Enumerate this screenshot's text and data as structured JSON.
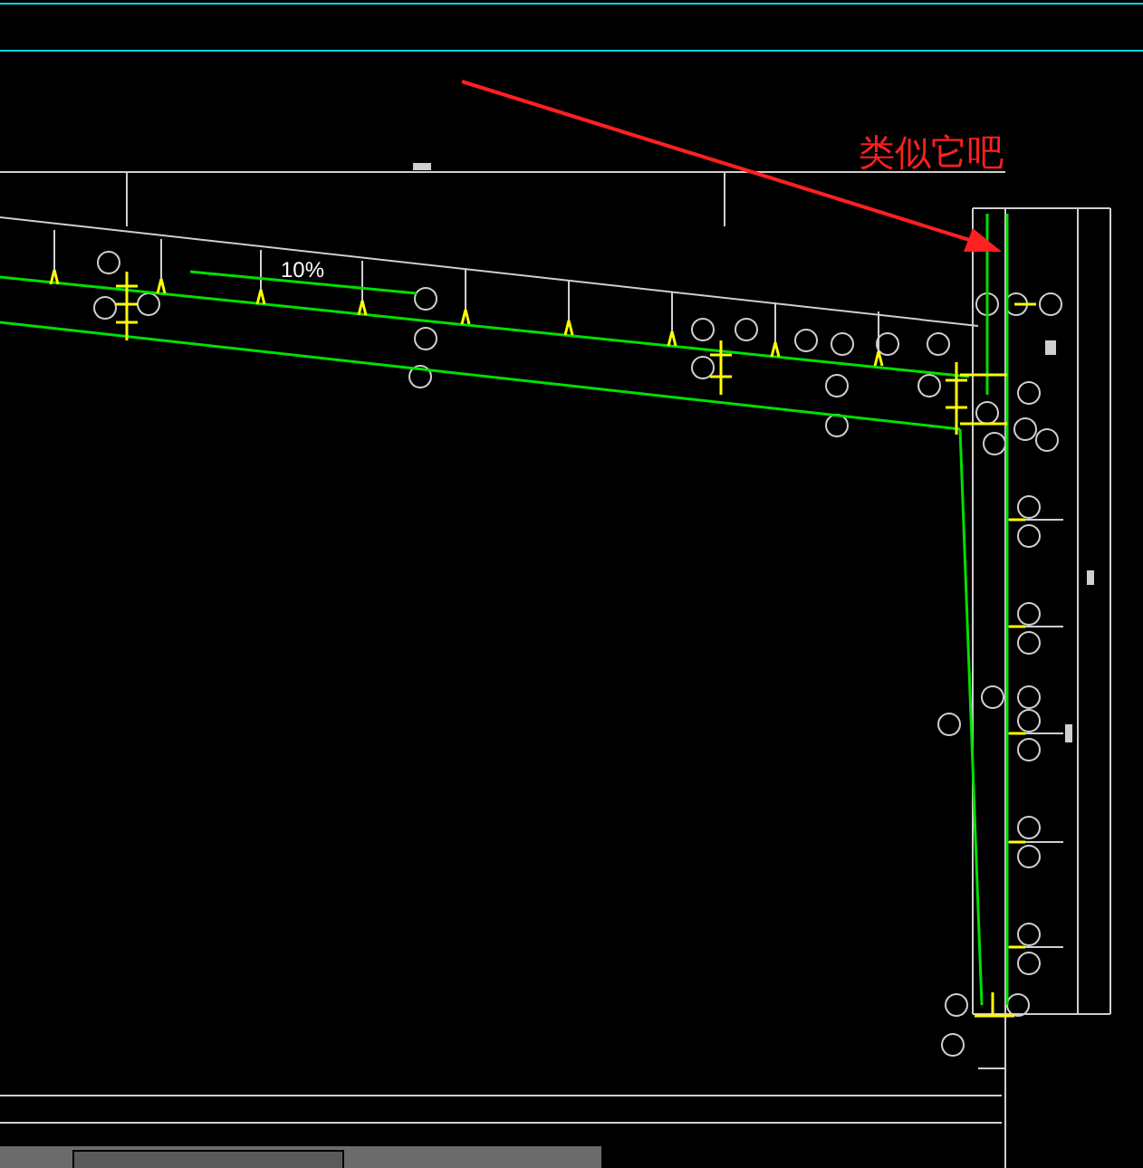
{
  "annotation": {
    "text": "类似它吧"
  },
  "drawing": {
    "slope_label": "10%"
  }
}
